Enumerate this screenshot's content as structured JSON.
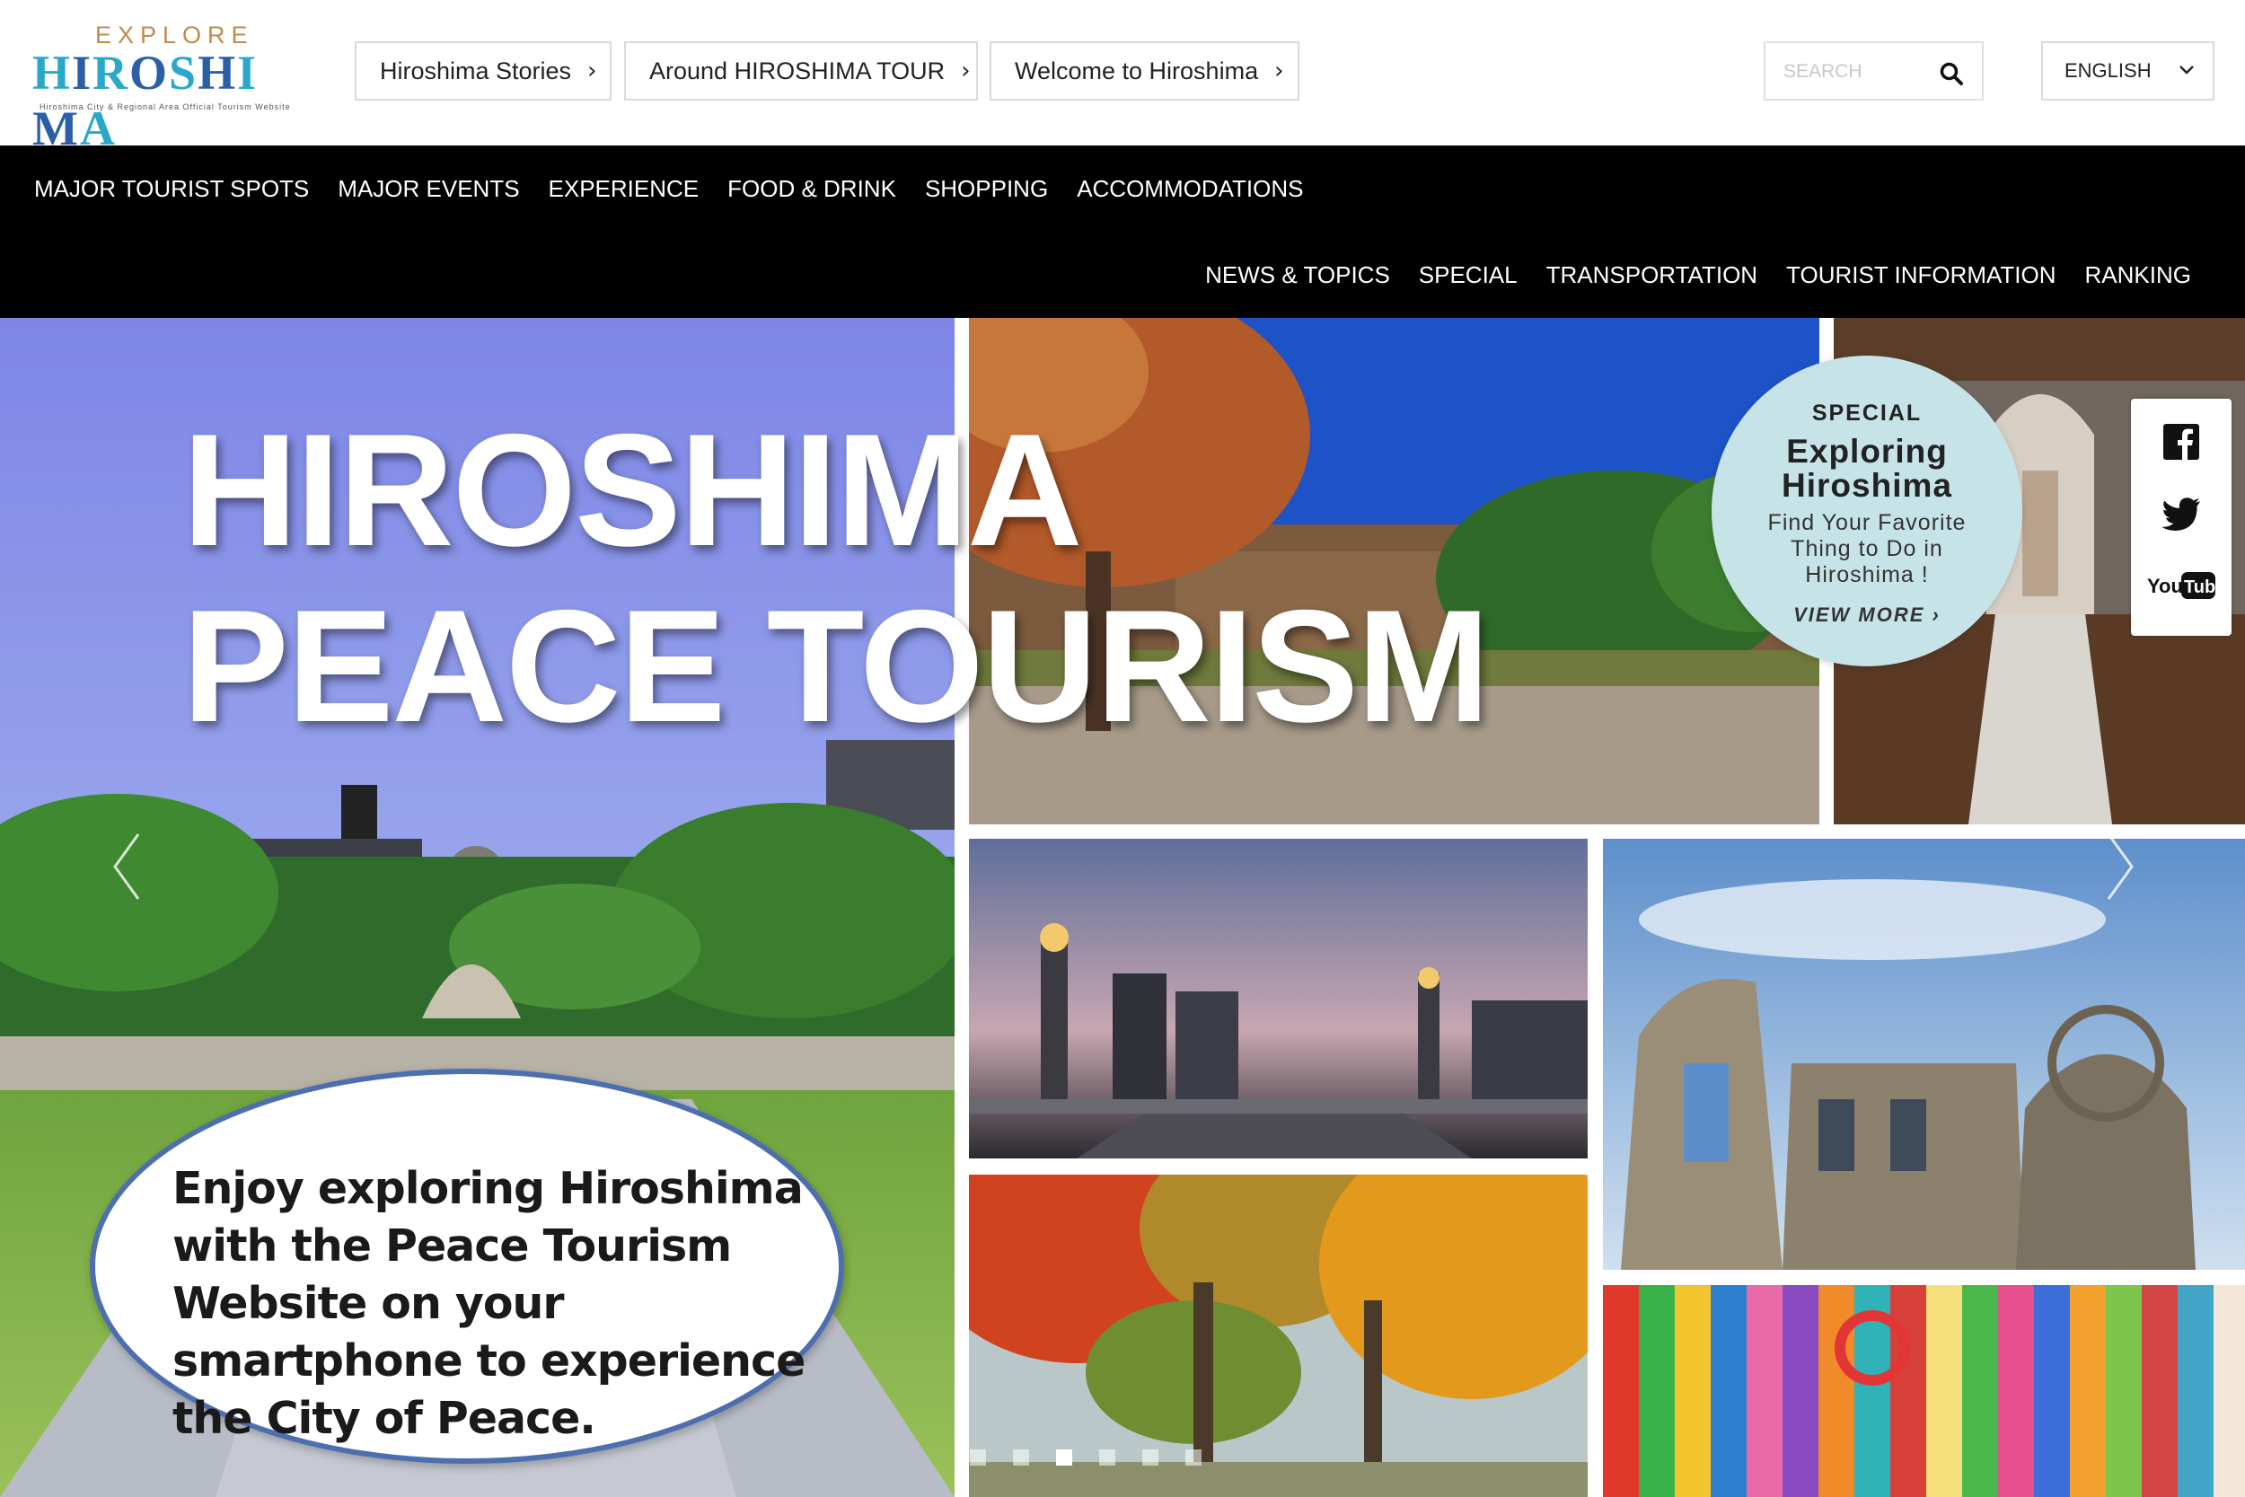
{
  "logo": {
    "explore": "EXPLORE",
    "main": "HIROSHIMA",
    "subtitle": "Hiroshima City & Regional Area Official Tourism Website"
  },
  "top_links": [
    {
      "label": "Hiroshima Stories"
    },
    {
      "label": "Around HIROSHIMA TOUR"
    },
    {
      "label": "Welcome to Hiroshima"
    }
  ],
  "search": {
    "placeholder": "SEARCH",
    "value": ""
  },
  "language": {
    "selected": "ENGLISH"
  },
  "nav": {
    "primary": [
      "MAJOR TOURIST SPOTS",
      "MAJOR EVENTS",
      "EXPERIENCE",
      "FOOD & DRINK",
      "SHOPPING",
      "ACCOMMODATIONS"
    ],
    "secondary": [
      "NEWS & TOPICS",
      "SPECIAL",
      "TRANSPORTATION",
      "TOURIST INFORMATION",
      "RANKING"
    ]
  },
  "hero": {
    "title_line1": "HIROSHIMA",
    "title_line2": "PEACE TOURISM",
    "caption": "Enjoy exploring Hiroshima with the Peace Tourism Website on your smartphone to experience the City of Peace."
  },
  "special": {
    "label": "SPECIAL",
    "title_line1": "Exploring",
    "title_line2": "Hiroshima",
    "description": "Find Your Favorite Thing to Do in Hiroshima !",
    "cta": "VIEW MORE"
  },
  "social": [
    {
      "icon": "facebook-icon"
    },
    {
      "icon": "twitter-icon"
    },
    {
      "icon": "youtube-icon",
      "text": "YouTube"
    }
  ],
  "carousel": {
    "slide_count": 6,
    "active_index": 2
  },
  "colors": {
    "nav_bg": "#000000",
    "badge_bg": "#c6e3e8",
    "speech_border": "#4d6fb0",
    "logo_blue": "#2aa8c9"
  }
}
